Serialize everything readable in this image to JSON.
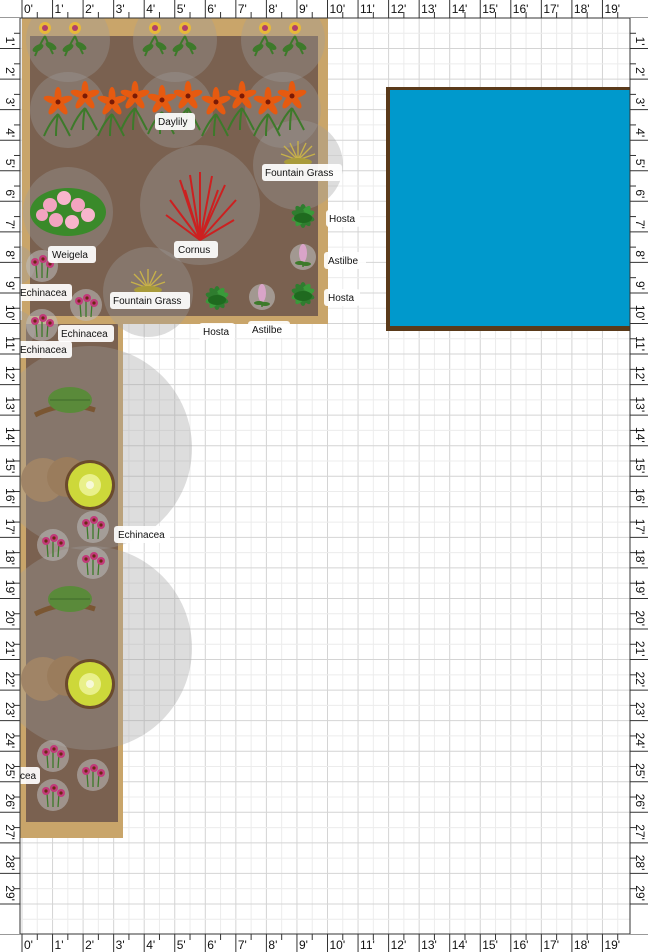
{
  "colors": {
    "grid_minor": "#e6e6e6",
    "grid_major": "#cfcfcf",
    "bed_frame": "#c9a56a",
    "bed_soil": "#7a6150",
    "pond_water": "#0099cc",
    "pond_border": "#5a3a1a",
    "spread_circle": "#9e9e9e"
  },
  "ruler": {
    "top": [
      "0'",
      "1'",
      "2'",
      "3'",
      "4'",
      "5'",
      "6'",
      "7'",
      "8'",
      "9'",
      "10'",
      "11'",
      "12'",
      "13'",
      "14'",
      "15'",
      "16'",
      "17'",
      "18'",
      "19'"
    ],
    "bottom": [
      "0'",
      "1'",
      "2'",
      "3'",
      "4'",
      "5'",
      "6'",
      "7'",
      "8'",
      "9'",
      "10'",
      "11'",
      "12'",
      "13'",
      "14'",
      "15'",
      "16'",
      "17'",
      "18'",
      "19'"
    ],
    "left": [
      "1'",
      "2'",
      "3'",
      "4'",
      "5'",
      "6'",
      "7'",
      "8'",
      "9'",
      "10'",
      "11'",
      "12'",
      "13'",
      "14'",
      "15'",
      "16'",
      "17'",
      "18'",
      "19'",
      "20'",
      "21'",
      "22'",
      "23'",
      "24'",
      "25'",
      "26'",
      "27'",
      "28'",
      "29'"
    ],
    "right": [
      "1'",
      "2'",
      "3'",
      "4'",
      "5'",
      "6'",
      "7'",
      "8'",
      "9'",
      "10'",
      "11'",
      "12'",
      "13'",
      "14'",
      "15'",
      "16'",
      "17'",
      "18'",
      "19'",
      "20'",
      "21'",
      "22'",
      "23'",
      "24'",
      "25'",
      "26'",
      "27'",
      "28'",
      "29'"
    ]
  },
  "labels": {
    "daylily": "Daylily",
    "fountain_grass_1": "Fountain Grass",
    "hosta_1": "Hosta",
    "weigela": "Weigela",
    "cornus": "Cornus",
    "astilbe_1": "Astilbe",
    "echinacea_1": "Echinacea",
    "fountain_grass_2": "Fountain Grass",
    "hosta_2": "Hosta",
    "echinacea_2": "Echinacea",
    "hosta_3": "Hosta",
    "astilbe_2": "Astilbe",
    "echinacea_3": "Echinacea",
    "echinacea_4": "Echinacea",
    "echinacea_5": "cea"
  },
  "icons": {
    "daylily": "daylily-icon",
    "fountain_grass": "fountain-grass-icon",
    "hosta": "hosta-icon",
    "weigela": "weigela-icon",
    "cornus": "cornus-icon",
    "astilbe": "astilbe-icon",
    "echinacea": "echinacea-icon",
    "kiwi": "kiwi-icon"
  }
}
